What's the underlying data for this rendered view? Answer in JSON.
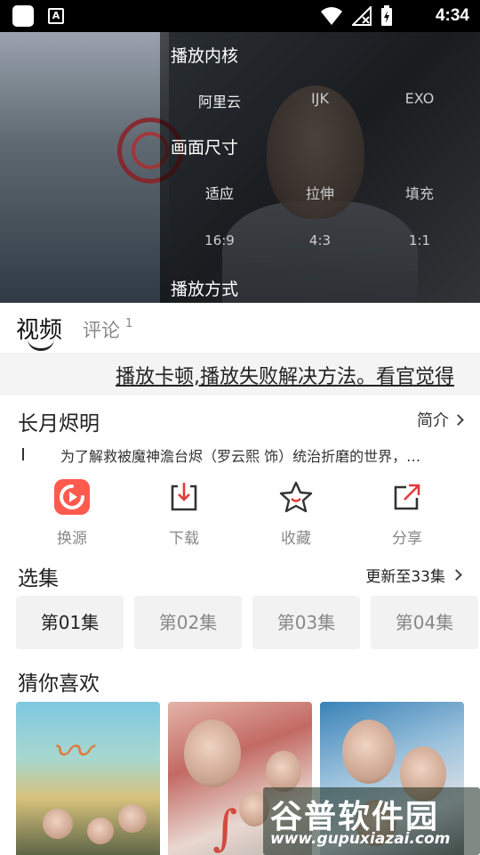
{
  "status_bar": {
    "time": "4:34"
  },
  "player_menu": {
    "core_title": "播放内核",
    "core_options": [
      "阿里云",
      "IJK",
      "EXO"
    ],
    "size_title": "画面尺寸",
    "size_options_row1": [
      "适应",
      "拉伸",
      "填充"
    ],
    "size_options_row2": [
      "16:9",
      "4:3",
      "1:1"
    ],
    "mode_title": "播放方式"
  },
  "tabs": {
    "video": "视频",
    "comment": "评论",
    "comment_count": "1"
  },
  "marquee": {
    "text": "播放卡顿,播放失败解决方法。看官觉得"
  },
  "info": {
    "title": "长月烬明",
    "intro_label": "简介",
    "description": "为了解救被魔神澹台烬（罗云熙 饰）统治折磨的世界，…"
  },
  "actions": [
    {
      "label": "换源",
      "icon": "switch-source-icon"
    },
    {
      "label": "下载",
      "icon": "download-icon"
    },
    {
      "label": "收藏",
      "icon": "star-icon"
    },
    {
      "label": "分享",
      "icon": "share-icon"
    }
  ],
  "episodes": {
    "title": "选集",
    "update_text": "更新至33集",
    "items": [
      "第01集",
      "第02集",
      "第03集",
      "第04集"
    ],
    "selected": "第01集"
  },
  "recommend": {
    "title": "猜你喜欢"
  },
  "watermark": {
    "main": "谷普软件园",
    "url": "www.gupuxiazai.com"
  },
  "colors": {
    "accent": "#ff4d4f",
    "icon_dark": "#333333"
  }
}
